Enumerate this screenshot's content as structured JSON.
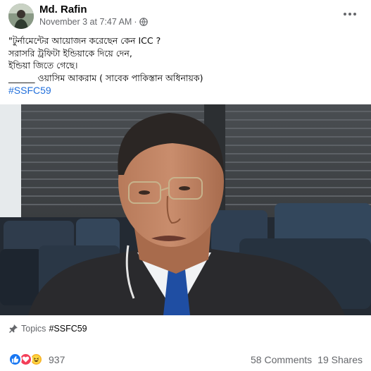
{
  "post": {
    "author": "Md. Rafin",
    "date": "November 3 at 7:47 AM",
    "separator": "·",
    "privacy_icon": "globe-icon",
    "more_icon": "more-options-icon",
    "text_lines": [
      "\"টুর্নামেন্টের আয়োজন করেছেন কেন ICC ?",
      "সরাসরি ট্রফিটা ইন্ডিয়াকে দিয়ে দেন,",
      "ইন্ডিয়া জিতে গেছে।",
      "______ ওয়াসিম আকরাম ( সাবেক পাকিস্তান  অধিনায়ক)"
    ],
    "hashtag": "#SSFC59"
  },
  "topics": {
    "label": "Topics",
    "tag": "#SSFC59",
    "icon": "pin-icon"
  },
  "footer": {
    "reaction_icons": [
      "like-icon",
      "love-icon",
      "haha-icon"
    ],
    "reaction_count": "937",
    "comments": "58 Comments",
    "shares": "19 Shares"
  },
  "colors": {
    "link": "#216fdb",
    "secondary_text": "#65676b",
    "like": "#1877f2",
    "love": "#f33e58",
    "haha": "#f7b125"
  }
}
